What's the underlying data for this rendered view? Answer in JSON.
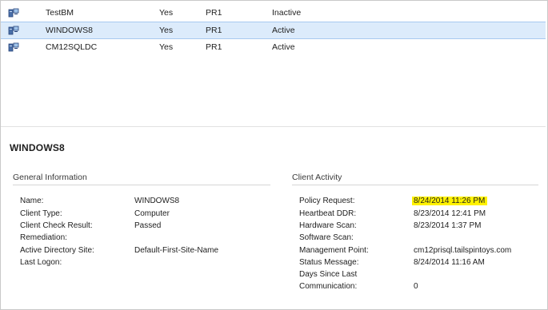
{
  "devices": [
    {
      "name": "TestBM",
      "client": "Yes",
      "site": "PR1",
      "status": "Inactive",
      "selected": false
    },
    {
      "name": "WINDOWS8",
      "client": "Yes",
      "site": "PR1",
      "status": "Active",
      "selected": true
    },
    {
      "name": "CM12SQLDC",
      "client": "Yes",
      "site": "PR1",
      "status": "Active",
      "selected": false
    }
  ],
  "details": {
    "title": "WINDOWS8",
    "general": {
      "heading": "General Information",
      "rows": [
        {
          "label": "Name:",
          "value": "WINDOWS8"
        },
        {
          "label": "Client Type:",
          "value": "Computer"
        },
        {
          "label": "Client Check Result:",
          "value": "Passed"
        },
        {
          "label": "Remediation:",
          "value": ""
        },
        {
          "label": "Active Directory Site:",
          "value": "Default-First-Site-Name"
        },
        {
          "label": "Last Logon:",
          "value": ""
        }
      ]
    },
    "activity": {
      "heading": "Client Activity",
      "rows": [
        {
          "label": "Policy Request:",
          "value": "8/24/2014 11:26 PM",
          "highlight": true
        },
        {
          "label": "Heartbeat DDR:",
          "value": "8/23/2014 12:41 PM"
        },
        {
          "label": "Hardware Scan:",
          "value": "8/23/2014 1:37 PM"
        },
        {
          "label": "Software Scan:",
          "value": ""
        },
        {
          "label": "Management Point:",
          "value": "cm12prisql.tailspintoys.com"
        },
        {
          "label": "Status Message:",
          "value": "8/24/2014 11:16 AM"
        },
        {
          "label": "Days Since Last",
          "value": ""
        },
        {
          "label": "Communication:",
          "value": "0"
        }
      ]
    }
  },
  "colors": {
    "selection_bg": "#dcebfb",
    "selection_border": "#a7c9ef",
    "highlight": "#fff200"
  },
  "icons": {
    "device": "computer-device-icon"
  }
}
